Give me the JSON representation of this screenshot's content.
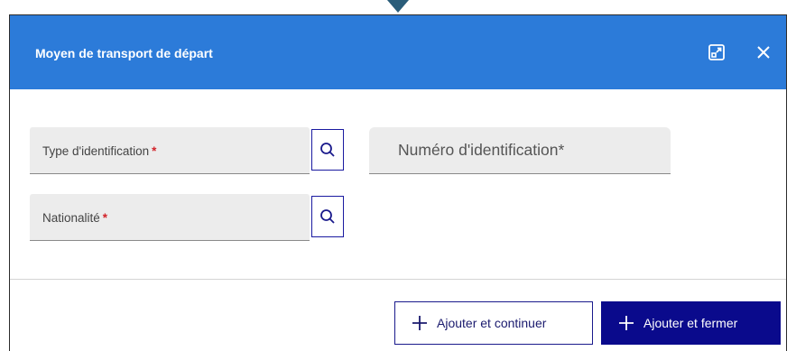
{
  "dialog": {
    "title": "Moyen de transport de départ",
    "header_icons": [
      "expand-icon",
      "close-icon"
    ]
  },
  "form": {
    "type_identification": {
      "label": "Type d'identification",
      "required_mark": "*",
      "lookup_icon": "search-icon"
    },
    "numero_identification": {
      "label": "Numéro d'identification",
      "required_mark": "*"
    },
    "nationalite": {
      "label": "Nationalité",
      "required_mark": "*",
      "lookup_icon": "search-icon"
    }
  },
  "footer": {
    "add_continue_label": "Ajouter et continuer",
    "add_close_label": "Ajouter et fermer",
    "button_icon": "plus-icon"
  },
  "colors": {
    "header_bg": "#2c7bd9",
    "primary_button": "#0a0a8c",
    "required": "#d2232a",
    "field_bg": "#ececec"
  }
}
